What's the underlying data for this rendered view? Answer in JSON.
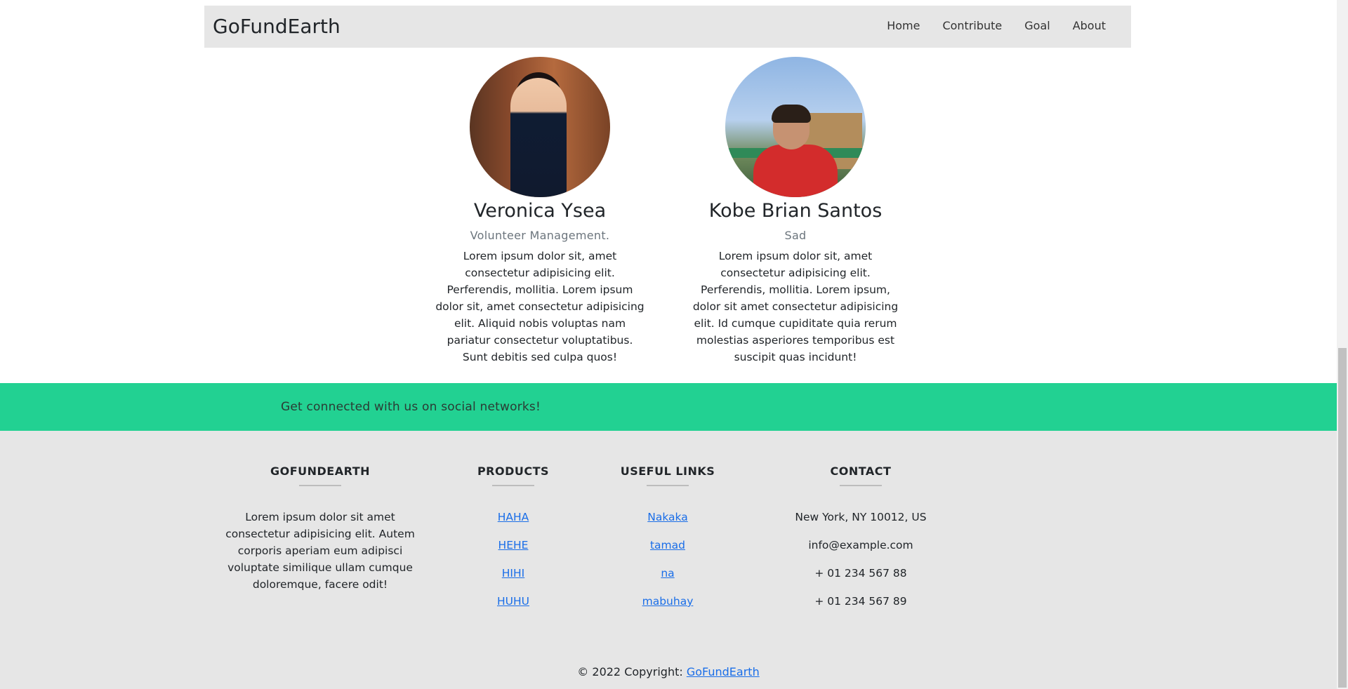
{
  "navbar": {
    "brand": "GoFundEarth",
    "links": [
      "Home",
      "Contribute",
      "Goal",
      "About"
    ]
  },
  "team": [
    {
      "name": "Veronica Ysea",
      "role": "Volunteer Management.",
      "bio": "Lorem ipsum dolor sit, amet consectetur adipisicing elit. Perferendis, mollitia. Lorem ipsum dolor sit, amet consectetur adipisicing elit. Aliquid nobis voluptas nam pariatur consectetur voluptatibus. Sunt debitis sed culpa quos!"
    },
    {
      "name": "Kobe Brian Santos",
      "role": "Sad",
      "bio": "Lorem ipsum dolor sit, amet consectetur adipisicing elit. Perferendis, mollitia. Lorem ipsum, dolor sit amet consectetur adipisicing elit. Id cumque cupiditate quia rerum molestias asperiores temporibus est suscipit quas incidunt!"
    }
  ],
  "social": {
    "text": "Get connected with us on social networks!"
  },
  "footer": {
    "about": {
      "heading": "GOFUNDEARTH",
      "text": "Lorem ipsum dolor sit amet consectetur adipisicing elit. Autem corporis aperiam eum adipisci voluptate similique ullam cumque doloremque, facere odit!"
    },
    "products": {
      "heading": "PRODUCTS",
      "links": [
        "HAHA",
        "HEHE",
        "HIHI",
        "HUHU"
      ]
    },
    "useful": {
      "heading": "USEFUL LINKS",
      "links": [
        "Nakaka",
        "tamad",
        "na",
        "mabuhay"
      ]
    },
    "contact": {
      "heading": "CONTACT",
      "items": [
        "New York, NY 10012, US",
        "info@example.com",
        "+ 01 234 567 88",
        "+ 01 234 567 89"
      ]
    },
    "copyright": {
      "prefix": "© 2022 Copyright: ",
      "link": "GoFundEarth"
    }
  },
  "colors": {
    "social_band": "#22d192",
    "footer_bg": "#e6e6e6",
    "navbar_bg": "#e6e6e6",
    "link": "#1a6ee8"
  }
}
